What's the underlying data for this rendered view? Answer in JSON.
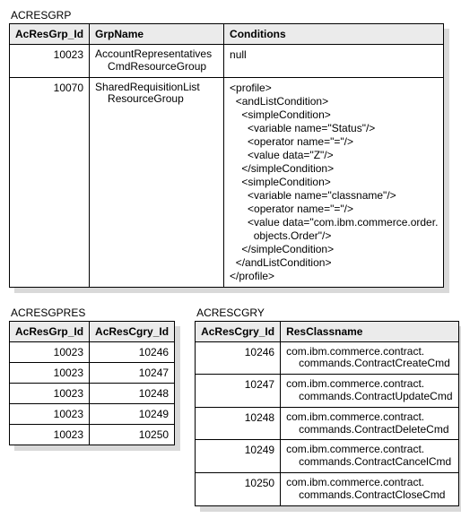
{
  "acresgrp": {
    "title": "ACRESGRP",
    "cols": [
      "AcResGrp_Id",
      "GrpName",
      "Conditions"
    ],
    "rows": [
      {
        "id": "10023",
        "name_l1": "AccountRepresentatives",
        "name_l2": "CmdResourceGroup",
        "cond_type": "plain",
        "cond_text": "null"
      },
      {
        "id": "10070",
        "name_l1": "SharedRequisitionList",
        "name_l2": "ResourceGroup",
        "cond_type": "xml",
        "xml": {
          "l0": "<profile>",
          "l1": "<andListCondition>",
          "l2a": "<simpleCondition>",
          "l3a": "<variable name=\"Status\"/>",
          "l3b": "<operator name=\"=\"/>",
          "l3c": "<value data=\"Z\"/>",
          "l2b": "</simpleCondition>",
          "l2c": "<simpleCondition>",
          "l3d": "<variable name=\"classname\"/>",
          "l3e": "<operator name=\"=\"/>",
          "l3f1": "<value data=\"com.ibm.commerce.order.",
          "l3f2": "objects.Order\"/>",
          "l2d": "</simpleCondition>",
          "l1e": "</andListCondition>",
          "l0e": "</profile>"
        }
      }
    ]
  },
  "acresgpres": {
    "title": "ACRESGPRES",
    "cols": [
      "AcResGrp_Id",
      "AcResCgry_Id"
    ],
    "rows": [
      {
        "a": "10023",
        "b": "10246"
      },
      {
        "a": "10023",
        "b": "10247"
      },
      {
        "a": "10023",
        "b": "10248"
      },
      {
        "a": "10023",
        "b": "10249"
      },
      {
        "a": "10023",
        "b": "10250"
      }
    ]
  },
  "acrescgry": {
    "title": "ACRESCGRY",
    "cols": [
      "AcResCgry_Id",
      "ResClassname"
    ],
    "rows": [
      {
        "id": "10246",
        "c1": "com.ibm.commerce.contract.",
        "c2": "commands.ContractCreateCmd"
      },
      {
        "id": "10247",
        "c1": "com.ibm.commerce.contract.",
        "c2": "commands.ContractUpdateCmd"
      },
      {
        "id": "10248",
        "c1": "com.ibm.commerce.contract.",
        "c2": "commands.ContractDeleteCmd"
      },
      {
        "id": "10249",
        "c1": "com.ibm.commerce.contract.",
        "c2": "commands.ContractCancelCmd"
      },
      {
        "id": "10250",
        "c1": "com.ibm.commerce.contract.",
        "c2": "commands.ContractCloseCmd"
      }
    ]
  }
}
